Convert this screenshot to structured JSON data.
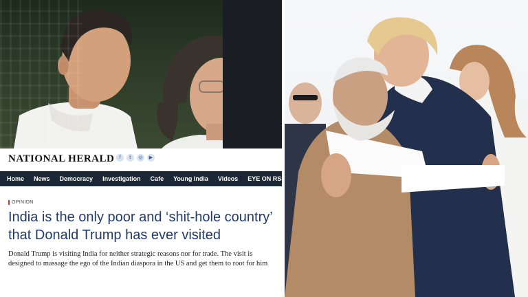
{
  "brand": {
    "logo_text": "NATIONAL HERALD",
    "social_icons": [
      "facebook-icon",
      "twitter-icon",
      "instagram-icon",
      "youtube-icon"
    ]
  },
  "nav": {
    "items": [
      "Home",
      "News",
      "Democracy",
      "Investigation",
      "Cafe",
      "Young India",
      "Videos",
      "EYE ON RSS"
    ]
  },
  "article": {
    "kicker": "OPINION",
    "headline": "India is the only poor and ‘shit-hole country’ that Donald Trump has ever visited",
    "lede": "Donald Trump is visiting India for neither strategic reasons nor for trade. The visit is designed to massage the ego of the Indian diaspora in the US and get them to root for him"
  },
  "colors": {
    "navbar_bg": "#1c2735",
    "headline": "#1f3b6b",
    "kicker_accent": "#c0392b"
  }
}
